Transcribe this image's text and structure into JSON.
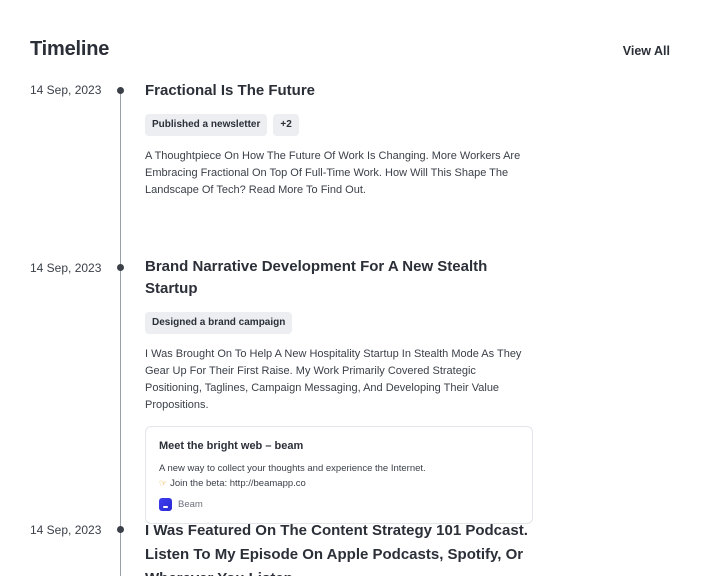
{
  "header": {
    "title": "Timeline",
    "view_all": "View All"
  },
  "entries": [
    {
      "date": "14 Sep, 2023",
      "title": "Fractional Is The Future",
      "tags": [
        "Published a newsletter",
        "+2"
      ],
      "description": "A Thoughtpiece On How The Future Of Work Is Changing. More Workers Are Embracing Fractional On Top Of Full-Time Work. How Will This Shape The Landscape Of Tech? Read More To Find Out."
    },
    {
      "date": "14 Sep, 2023",
      "title": "Brand Narrative Development For A New Stealth Startup",
      "tags": [
        "Designed a brand campaign"
      ],
      "description": "I Was Brought On To Help A New Hospitality Startup In Stealth Mode As They Gear Up For Their First Raise. My Work Primarily Covered Strategic Positioning, Taglines, Campaign Messaging, And Developing Their Value Propositions.",
      "card": {
        "title": "Meet the bright web – beam",
        "description": "A new way to collect your thoughts and experience the Internet.",
        "hand_icon": "pointing-hand-icon",
        "cta": "Join the beta: http://beamapp.co",
        "source_icon": "beam-logo-icon",
        "source": "Beam"
      }
    },
    {
      "date": "14 Sep, 2023",
      "title": "I Was Featured On The Content Strategy 101 Podcast. Listen To My Episode On Apple Podcasts, Spotify, Or Wherever You Listen."
    }
  ]
}
